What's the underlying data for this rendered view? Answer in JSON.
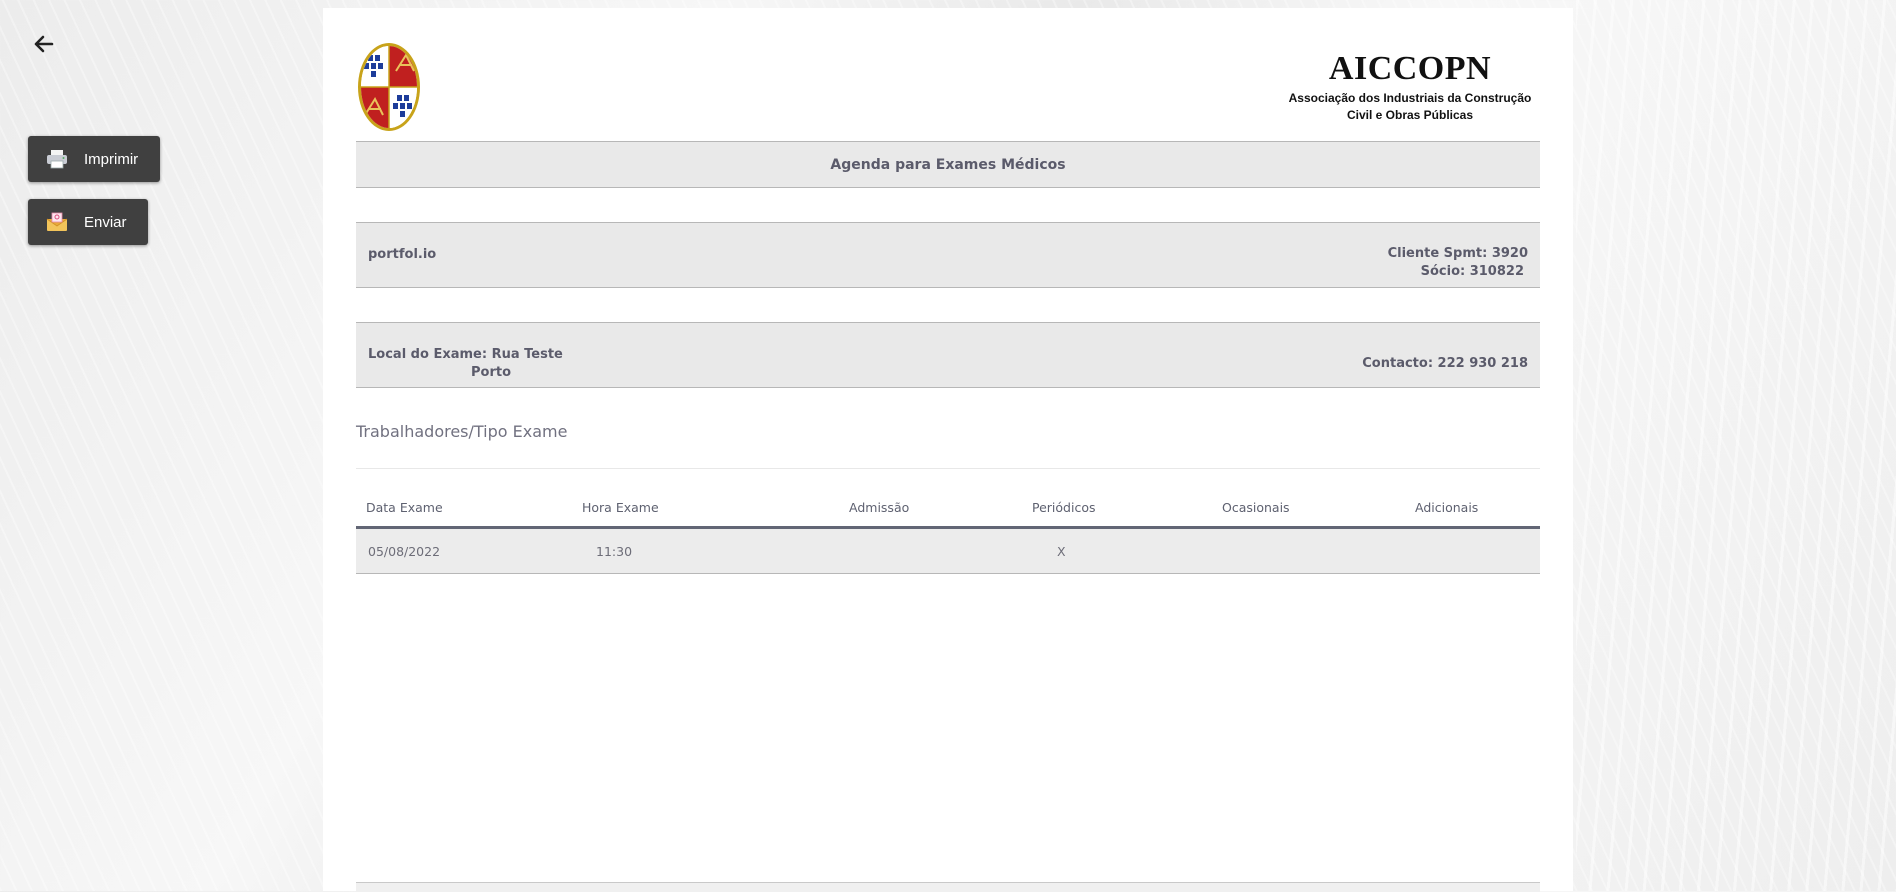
{
  "nav": {
    "back_icon": "arrow-left-icon"
  },
  "actions": {
    "print": {
      "label": "Imprimir",
      "icon": "printer-icon"
    },
    "send": {
      "label": "Enviar",
      "icon": "envelope-icon"
    }
  },
  "header": {
    "logo": "coat-of-arms-logo",
    "brand_name": "AICCOPN",
    "brand_sub_line1": "Associação dos Industriais da Construção",
    "brand_sub_line2": "Civil e Obras Públicas"
  },
  "document": {
    "title": "Agenda para Exames Médicos",
    "client": {
      "name": "portfol.io",
      "cliente_spmt": "Cliente Spmt: 3920",
      "socio": "Sócio: 310822"
    },
    "local": {
      "line1": "Local do Exame: Rua Teste",
      "line2": "Porto",
      "contacto": "Contacto: 222 930 218"
    },
    "section_title": "Trabalhadores/Tipo Exame",
    "table": {
      "headers": [
        "Data Exame",
        "Hora Exame",
        "Admissão",
        "Periódicos",
        "Ocasionais",
        "Adicionais"
      ],
      "rows": [
        [
          "05/08/2022",
          "11:30",
          "",
          "X",
          "",
          ""
        ]
      ]
    }
  },
  "colors": {
    "button_bg": "#404040",
    "band_bg": "#e9e9e9",
    "text_muted": "#5b5b6b"
  }
}
